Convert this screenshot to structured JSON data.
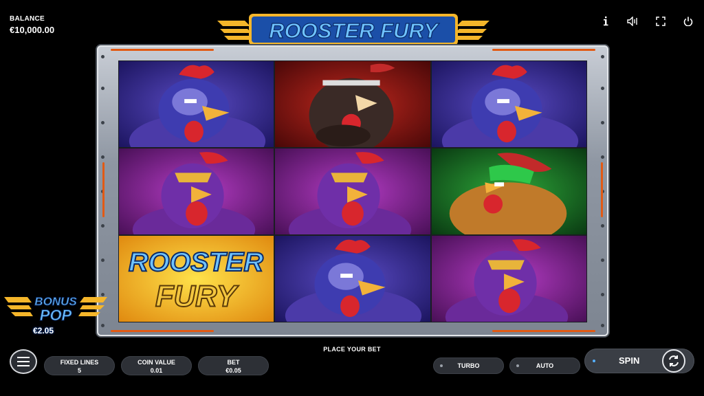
{
  "balance": {
    "label": "BALANCE",
    "value": "€10,000.00"
  },
  "logo": {
    "text": "ROOSTER FURY"
  },
  "top_icons": [
    "info-icon",
    "sound-icon",
    "fullscreen-icon",
    "power-icon"
  ],
  "reels": [
    [
      "blue-rooster",
      "purple-rooster",
      "logo-wild"
    ],
    [
      "dark-rooster",
      "purple-rooster",
      "blue-rooster"
    ],
    [
      "blue-rooster",
      "green-rooster",
      "purple-rooster"
    ]
  ],
  "wild_symbol": {
    "line1": "ROOSTER",
    "line2": "FURY"
  },
  "bonus_pop": {
    "line1": "BONUS",
    "line2": "POP",
    "amount": "€2.05"
  },
  "message": "PLACE YOUR BET",
  "controls": {
    "fixed_lines": {
      "label": "FIXED LINES",
      "value": "5"
    },
    "coin_value": {
      "label": "COIN VALUE",
      "value": "0.01"
    },
    "bet": {
      "label": "BET",
      "value": "€0.05"
    },
    "turbo": "TURBO",
    "auto": "AUTO",
    "spin": "SPIN"
  },
  "colors": {
    "accent_orange": "#e25a14",
    "logo_blue": "#2a7de1",
    "logo_gold": "#f5b62a",
    "spin_dot": "#55b0ff"
  }
}
